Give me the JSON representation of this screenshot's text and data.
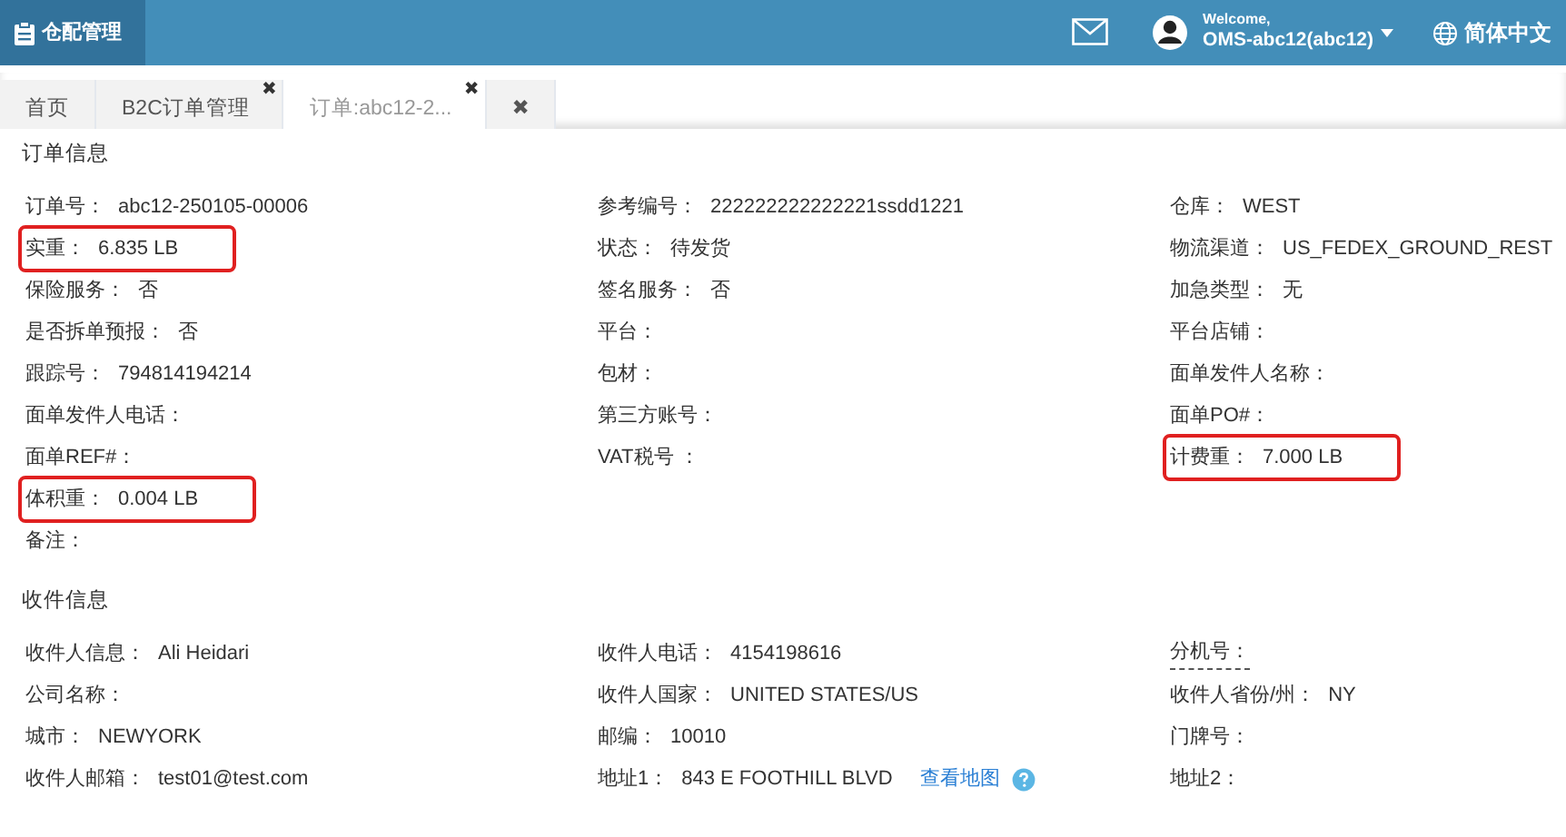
{
  "header": {
    "app_title": "仓配管理",
    "welcome": "Welcome,",
    "user": "OMS-abc12(abc12)",
    "language": "简体中文"
  },
  "tabs": [
    {
      "label": "首页",
      "selected": false
    },
    {
      "label": "B2C订单管理",
      "selected": false,
      "close": "✖"
    },
    {
      "label": "订单:abc12-2...",
      "selected": true,
      "close": "✖"
    },
    {
      "label": "✖",
      "selected": false
    }
  ],
  "sections": [
    {
      "title": "订单信息",
      "rows": [
        [
          {
            "label": "订单号：",
            "value": "abc12-250105-00006",
            "highlighted": false
          },
          {
            "label": "参考编号：",
            "value": "222222222222221ssdd1221",
            "highlighted": false
          },
          {
            "label": "仓库：",
            "value": "WEST",
            "highlighted": false
          }
        ],
        [
          {
            "label": "实重：",
            "value": "6.835 LB",
            "highlighted": true
          },
          {
            "label": "状态：",
            "value": "待发货",
            "highlighted": false
          },
          {
            "label": "物流渠道：",
            "value": "US_FEDEX_GROUND_REST",
            "highlighted": false
          }
        ],
        [
          {
            "label": "保险服务：",
            "value": "否",
            "highlighted": false
          },
          {
            "label": "签名服务：",
            "value": "否",
            "highlighted": false
          },
          {
            "label": "加急类型：",
            "value": "无",
            "highlighted": false
          }
        ],
        [
          {
            "label": "是否拆单预报：",
            "value": "否",
            "highlighted": false
          },
          {
            "label": "平台：",
            "highlighted": false
          },
          {
            "label": "平台店铺：",
            "highlighted": false
          }
        ],
        [
          {
            "label": "跟踪号：",
            "value": "794814194214",
            "highlighted": false
          },
          {
            "label": "包材：",
            "highlighted": false
          },
          {
            "label": "面单发件人名称：",
            "highlighted": false
          }
        ],
        [
          {
            "label": "面单发件人电话：",
            "highlighted": false
          },
          {
            "label": "第三方账号：",
            "highlighted": false
          },
          {
            "label": "面单PO#：",
            "highlighted": false
          }
        ],
        [
          {
            "label": "面单REF#：",
            "highlighted": false
          },
          {
            "label": "VAT税号 ：",
            "highlighted": false
          },
          {
            "label": "计费重：",
            "value": "7.000 LB",
            "highlighted": true
          }
        ],
        [
          {
            "label": "体积重：",
            "value": "0.004 LB",
            "highlighted": true
          }
        ],
        [
          {
            "label": "备注：",
            "highlighted": false
          }
        ]
      ]
    },
    {
      "title": "收件信息",
      "rows": [
        [
          {
            "label": "收件人信息：",
            "value": "Ali Heidari",
            "highlighted": false
          },
          {
            "label": "收件人电话：",
            "value": "4154198616",
            "highlighted": false
          },
          {
            "label": "分机号：",
            "highlighted": false,
            "tooltip": true
          }
        ],
        [
          {
            "label": "公司名称：",
            "highlighted": false
          },
          {
            "label": "收件人国家：",
            "value": "UNITED STATES/US",
            "highlighted": false
          },
          {
            "label": "收件人省份/州：",
            "value": "NY",
            "highlighted": false
          }
        ],
        [
          {
            "label": "城市：",
            "value": "NEWYORK",
            "highlighted": false
          },
          {
            "label": "邮编：",
            "value": "10010",
            "highlighted": false
          },
          {
            "label": "门牌号：",
            "highlighted": false
          }
        ],
        [
          {
            "label": "收件人邮箱：",
            "value": "test01@test.com",
            "highlighted": false
          },
          {
            "label": "地址1：",
            "value": "843 E FOOTHILL BLVD",
            "link": "查看地图",
            "highlighted": false
          },
          {
            "label": "地址2：",
            "highlighted": false
          }
        ]
      ]
    }
  ]
}
